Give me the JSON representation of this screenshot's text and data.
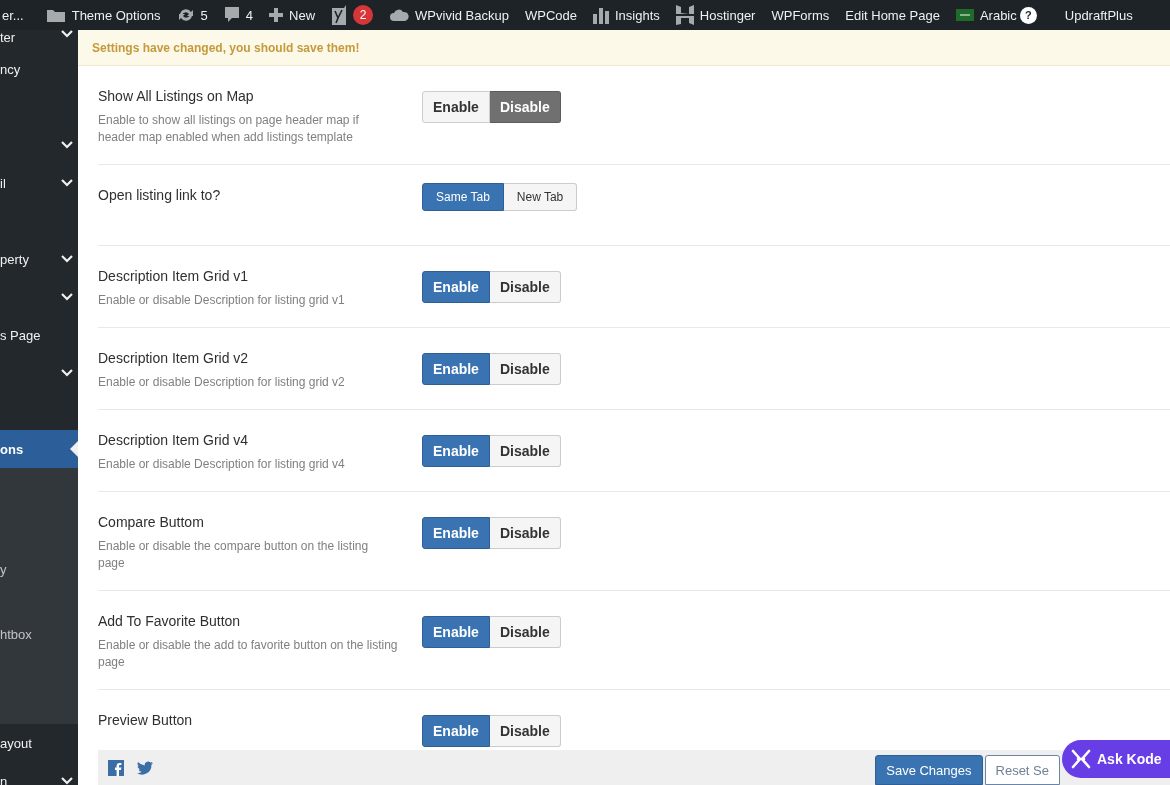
{
  "admin_bar": {
    "items": [
      {
        "kind": "text",
        "label": "er..."
      },
      {
        "kind": "folder",
        "label": "Theme Options"
      },
      {
        "kind": "updates",
        "label": "5"
      },
      {
        "kind": "comments",
        "label": "4"
      },
      {
        "kind": "plus",
        "label": "New"
      },
      {
        "kind": "yoast",
        "badge": "2"
      },
      {
        "kind": "cloud",
        "label": "WPvivid Backup"
      },
      {
        "kind": "text",
        "label": "WPCode"
      },
      {
        "kind": "bars",
        "label": "Insights"
      },
      {
        "kind": "hostinger",
        "label": "Hostinger"
      },
      {
        "kind": "text",
        "label": "WPForms"
      },
      {
        "kind": "text",
        "label": "Edit Home Page"
      },
      {
        "kind": "flag",
        "label": "Arabic",
        "help": "?"
      },
      {
        "kind": "text",
        "label": "UpdraftPlus"
      }
    ]
  },
  "sidebar": {
    "items": [
      {
        "label": "ter",
        "chevron": true,
        "selected": false
      },
      {
        "label": "ncy",
        "chevron": false,
        "selected": false
      },
      {
        "chevron": true,
        "selected": false
      },
      {
        "label": "il",
        "chevron": true,
        "selected": false
      },
      {
        "label": "perty",
        "chevron": true,
        "selected": false
      },
      {
        "chevron": true,
        "selected": false
      },
      {
        "label": "s Page",
        "chevron": false,
        "selected": false
      },
      {
        "chevron": true,
        "selected": false
      },
      {
        "label": "ons",
        "chevron": false,
        "selected": true
      }
    ],
    "submenu": [
      {
        "label": "y"
      },
      {
        "label": "htbox"
      }
    ],
    "bottom_items": [
      {
        "label": "ayout",
        "chevron": false
      },
      {
        "label": "n",
        "chevron": true
      }
    ]
  },
  "notice": {
    "text": "Settings have changed, you should save them!"
  },
  "settings": [
    {
      "title": "Show All Listings on Map",
      "description": "Enable to show all listings on page header map if header map enabled when add listings template",
      "options": [
        {
          "label": "Enable",
          "selected": false
        },
        {
          "label": "Disable",
          "selected": true
        }
      ]
    },
    {
      "title": "Open listing link to?",
      "options": [
        {
          "label": "Same Tab",
          "selected": true
        },
        {
          "label": "New Tab",
          "selected": false
        }
      ]
    },
    {
      "title": "Description Item Grid v1",
      "description": "Enable or disable Description for listing grid v1",
      "options": [
        {
          "label": "Enable",
          "selected": true
        },
        {
          "label": "Disable",
          "selected": false
        }
      ]
    },
    {
      "title": "Description Item Grid v2",
      "description": "Enable or disable Description for listing grid v2",
      "options": [
        {
          "label": "Enable",
          "selected": true
        },
        {
          "label": "Disable",
          "selected": false
        }
      ]
    },
    {
      "title": "Description Item Grid v4",
      "description": "Enable or disable Description for listing grid v4",
      "options": [
        {
          "label": "Enable",
          "selected": true
        },
        {
          "label": "Disable",
          "selected": false
        }
      ]
    },
    {
      "title": "Compare Buttom",
      "description": "Enable or disable the compare button on the listing page",
      "options": [
        {
          "label": "Enable",
          "selected": true
        },
        {
          "label": "Disable",
          "selected": false
        }
      ]
    },
    {
      "title": "Add To Favorite Button",
      "description": "Enable or disable the add to favorite button on the listing page",
      "options": [
        {
          "label": "Enable",
          "selected": true
        },
        {
          "label": "Disable",
          "selected": false
        }
      ]
    },
    {
      "title": "Preview Button",
      "options": [
        {
          "label": "Enable",
          "selected": true
        },
        {
          "label": "Disable",
          "selected": false
        }
      ]
    }
  ],
  "footer": {
    "buttons": [
      {
        "label": "Save Changes",
        "kind": "primary"
      },
      {
        "label": "Reset Se",
        "kind": "secondary"
      }
    ]
  },
  "chat_button": {
    "label": "Ask Kode"
  }
}
